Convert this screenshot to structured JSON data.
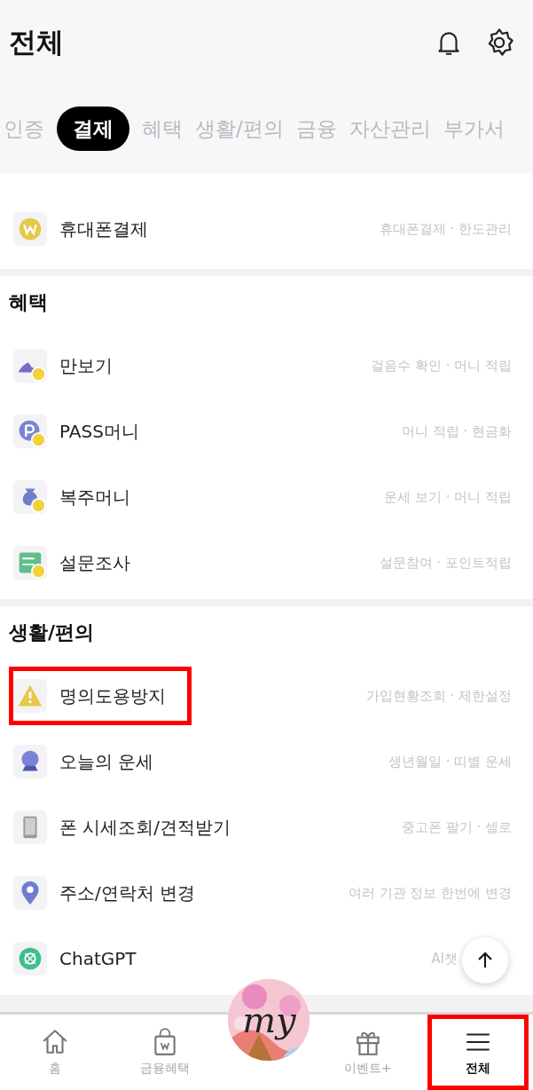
{
  "header": {
    "title": "전체"
  },
  "tabs": [
    {
      "label": "인증",
      "selected": false
    },
    {
      "label": "결제",
      "selected": true
    },
    {
      "label": "혜택",
      "selected": false
    },
    {
      "label": "생활/편의",
      "selected": false
    },
    {
      "label": "금융",
      "selected": false
    },
    {
      "label": "자산관리",
      "selected": false
    },
    {
      "label": "부가서",
      "selected": false
    }
  ],
  "sections": [
    {
      "items": [
        {
          "kind": "coin",
          "name": "휴대폰결제",
          "description": "휴대폰결제 · 한도관리",
          "highlighted": false
        }
      ]
    },
    {
      "title": "혜택",
      "items": [
        {
          "kind": "shoe",
          "name": "만보기",
          "description": "걸음수 확인 · 머니 적립",
          "highlighted": false
        },
        {
          "kind": "pass",
          "name": "PASS머니",
          "description": "머니 적립 · 현금화",
          "highlighted": false
        },
        {
          "kind": "pouch",
          "name": "복주머니",
          "description": "운세 보기 · 머니 적립",
          "highlighted": false
        },
        {
          "kind": "survey",
          "name": "설문조사",
          "description": "설문참여 · 포인트적립",
          "highlighted": false
        }
      ]
    },
    {
      "title": "생활/편의",
      "items": [
        {
          "kind": "warning",
          "name": "명의도용방지",
          "description": "가입현황조회 · 제한설정",
          "highlighted": true
        },
        {
          "kind": "crystal",
          "name": "오늘의 운세",
          "description": "생년월일 · 띠별 운세",
          "highlighted": false
        },
        {
          "kind": "phone",
          "name": "폰 시세조회/견적받기",
          "description": "중고폰 팔기 · 셀로",
          "highlighted": false
        },
        {
          "kind": "pin",
          "name": "주소/연락처 변경",
          "description": "여러 기관 정보 한번에 변경",
          "highlighted": false
        },
        {
          "kind": "chatgpt",
          "name": "ChatGPT",
          "description": "AI챗",
          "highlighted": false
        }
      ]
    }
  ],
  "bottom_nav": [
    {
      "kind": "home",
      "label": "홈",
      "selected": false,
      "highlighted": false
    },
    {
      "kind": "bag",
      "label": "금융혜택",
      "selected": false,
      "highlighted": false
    },
    {
      "kind": "my",
      "label": "my"
    },
    {
      "kind": "gift",
      "label": "이벤트+",
      "selected": false,
      "highlighted": false
    },
    {
      "kind": "menu",
      "label": "전체",
      "selected": true,
      "highlighted": true
    }
  ]
}
